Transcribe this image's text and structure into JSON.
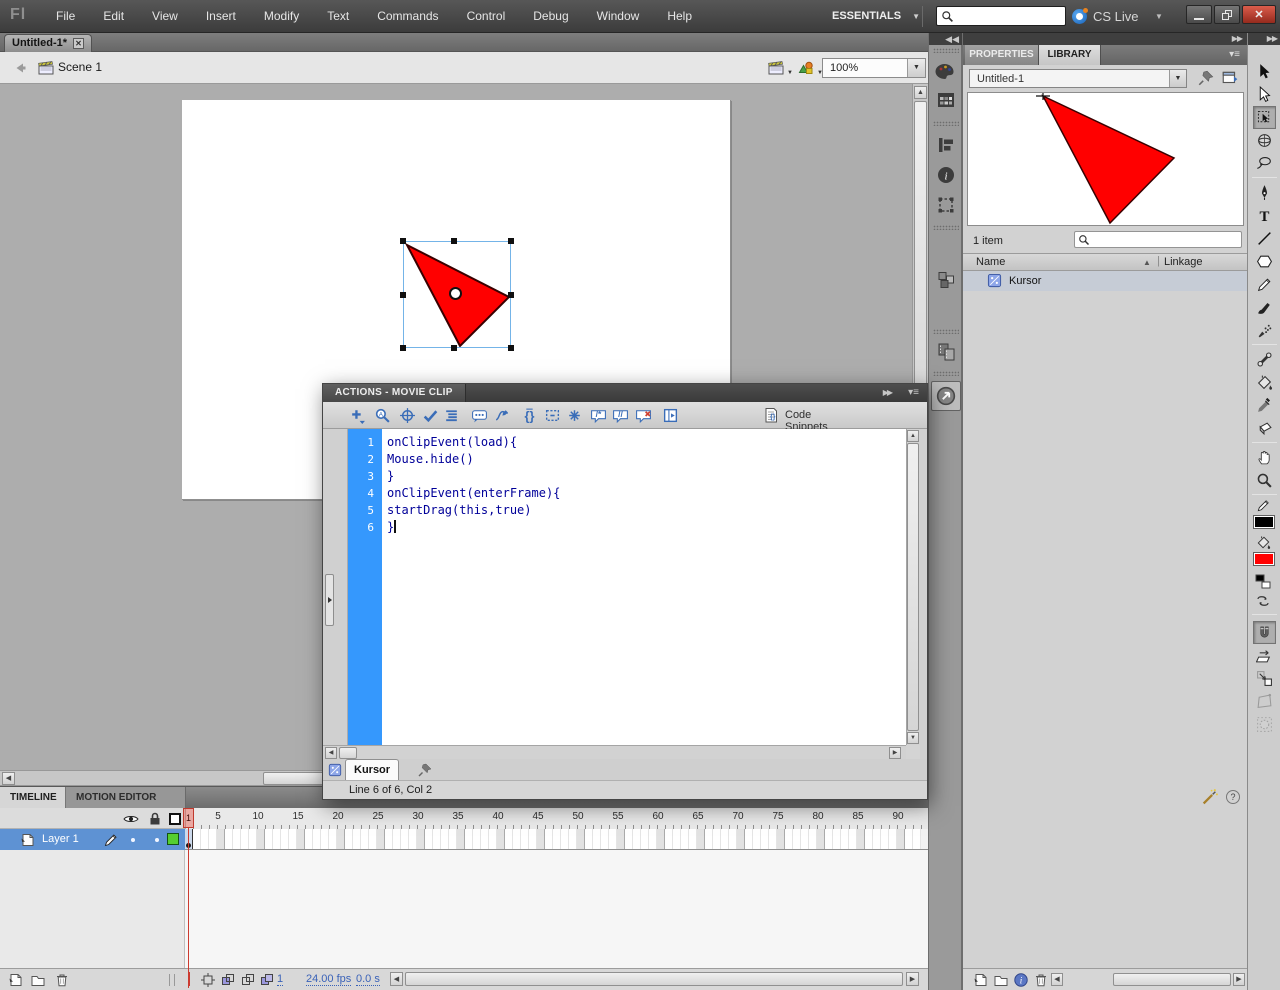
{
  "colors": {
    "triangle_fill": "#ff0000",
    "triangle_stroke": "#3a0000",
    "gutter_blue": "#3598fd",
    "code_text": "#000099",
    "layer_row_blue": "#5e92d3",
    "playhead_red": "#cc3b30",
    "stroke_swatch": "#000000",
    "fill_swatch": "#ff0000",
    "layer_outline_swatch": "#55ce30"
  },
  "menu_bar": {
    "logo_text": "Fl",
    "items": [
      "File",
      "Edit",
      "View",
      "Insert",
      "Modify",
      "Text",
      "Commands",
      "Control",
      "Debug",
      "Window",
      "Help"
    ],
    "workspace": "ESSENTIALS",
    "search_value": "",
    "cs_live": "CS Live"
  },
  "document_tab": {
    "label": "Untitled-1*"
  },
  "edit_bar": {
    "scene": "Scene 1",
    "zoom": "100%"
  },
  "actions_panel": {
    "title": "ACTIONS - MOVIE CLIP",
    "toolbar": [
      "add-new-item",
      "find",
      "insert-target-path",
      "check-syntax",
      "auto-format",
      "show-code-hint",
      "debug-options",
      "collapse-between-braces",
      "collapse-selection",
      "expand-all",
      "apply-block-comment",
      "apply-line-comment",
      "remove-comment",
      "show-hide-toolbox"
    ],
    "code_snippets": "Code Snippets",
    "lines": [
      {
        "n": "1",
        "code": "onClipEvent(load){"
      },
      {
        "n": "2",
        "code": "Mouse.hide()"
      },
      {
        "n": "3",
        "code": "}"
      },
      {
        "n": "4",
        "code": "onClipEvent(enterFrame){"
      },
      {
        "n": "5",
        "code": "startDrag(this,true)"
      },
      {
        "n": "6",
        "code": "}"
      }
    ],
    "script_tab": "Kursor",
    "status": "Line 6 of 6, Col 2"
  },
  "timeline": {
    "tabs": [
      {
        "label": "TIMELINE",
        "active": true
      },
      {
        "label": "MOTION EDITOR",
        "active": false
      }
    ],
    "layers": [
      {
        "name": "Layer 1",
        "selected": true
      }
    ],
    "ruler_labels": [
      "5",
      "10",
      "15",
      "20",
      "25",
      "30",
      "35",
      "40",
      "45",
      "50",
      "55",
      "60",
      "65",
      "70",
      "75",
      "80",
      "85",
      "90"
    ],
    "current_frame": "1",
    "fps": "24.00 fps",
    "elapsed": "0.0 s"
  },
  "dock_strip": {
    "icons": [
      "color",
      "swatches",
      "align",
      "info",
      "transform",
      "code-snippets",
      "components",
      "motion-presets",
      "project",
      "actions"
    ],
    "active_icon": "actions"
  },
  "library": {
    "tabs": [
      {
        "label": "PROPERTIES",
        "active": false
      },
      {
        "label": "LIBRARY",
        "active": true
      }
    ],
    "document": "Untitled-1",
    "count": "1 item",
    "search_value": "",
    "columns": {
      "name": "Name",
      "linkage": "Linkage"
    },
    "items": [
      {
        "name": "Kursor",
        "type": "movie-clip",
        "selected": true
      }
    ]
  },
  "tools": {
    "list": [
      {
        "name": "selection-tool",
        "icon": "arrow-black"
      },
      {
        "name": "subselection-tool",
        "icon": "arrow-white"
      },
      {
        "name": "free-transform-tool",
        "icon": "free-transform",
        "active": true
      },
      {
        "name": "3d-rotation-tool",
        "icon": "rotate3d"
      },
      {
        "name": "lasso-tool",
        "icon": "lasso",
        "div": true
      },
      {
        "name": "pen-tool",
        "icon": "pen"
      },
      {
        "name": "text-tool",
        "icon": "text"
      },
      {
        "name": "line-tool",
        "icon": "line"
      },
      {
        "name": "shape-tool",
        "icon": "polystar"
      },
      {
        "name": "pencil-tool",
        "icon": "pencil"
      },
      {
        "name": "brush-tool",
        "icon": "brush"
      },
      {
        "name": "spray-brush-tool",
        "icon": "spray",
        "div": true
      },
      {
        "name": "bone-tool",
        "icon": "bone"
      },
      {
        "name": "paint-bucket-tool",
        "icon": "bucket"
      },
      {
        "name": "eyedropper-tool",
        "icon": "eyedropper"
      },
      {
        "name": "eraser-tool",
        "icon": "eraser",
        "div": true
      },
      {
        "name": "hand-tool",
        "icon": "hand"
      },
      {
        "name": "zoom-tool",
        "icon": "magnifier",
        "div": true
      }
    ],
    "options": [
      {
        "name": "snap-to-objects",
        "icon": "magnet",
        "active": true
      },
      {
        "name": "rotate-and-skew",
        "icon": "rotate-skew"
      },
      {
        "name": "scale",
        "icon": "scale"
      },
      {
        "name": "distort",
        "icon": "distort",
        "disabled": true
      },
      {
        "name": "envelope",
        "icon": "envelope",
        "disabled": true
      }
    ]
  }
}
